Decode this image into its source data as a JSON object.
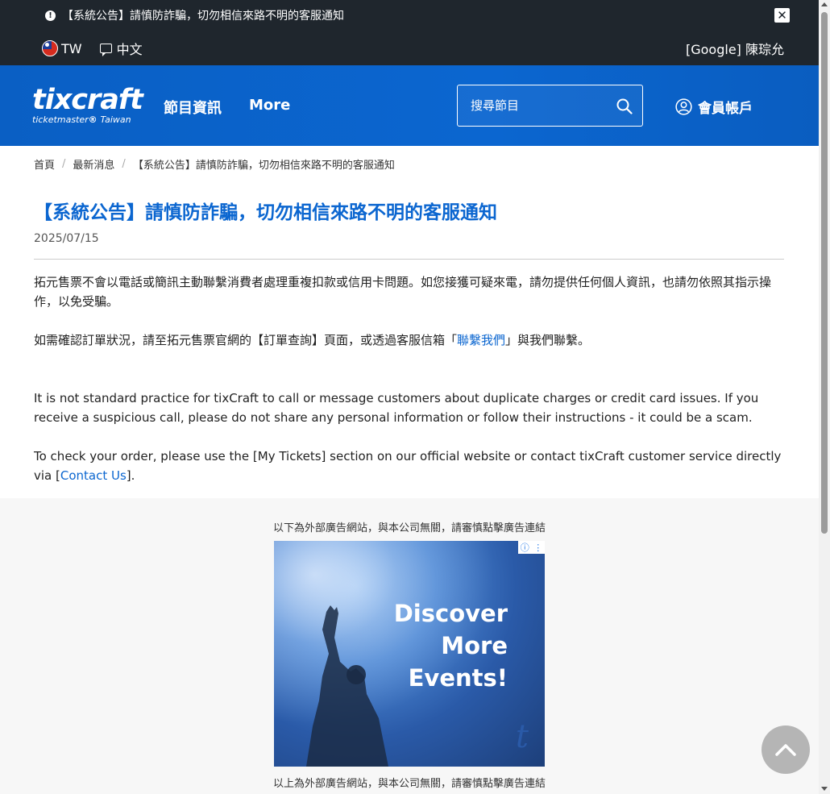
{
  "announcement_bar": {
    "text": "【系統公告】請慎防詐騙，切勿相信來路不明的客服通知",
    "icon": "exclamation-circle-icon",
    "close_icon": "close-icon"
  },
  "locale": {
    "region": "TW",
    "language": "中文",
    "user": "[Google] 陳琮允"
  },
  "header": {
    "logo_main": "tixcraft",
    "logo_sub_brand": "ticketmaster",
    "logo_sub_region": "Taiwan",
    "nav": [
      "節目資訊",
      "More"
    ],
    "search_placeholder": "搜尋節目",
    "account_label": "會員帳戶"
  },
  "breadcrumb": [
    "首頁",
    "最新消息",
    "【系統公告】請慎防詐騙，切勿相信來路不明的客服通知"
  ],
  "article": {
    "title": "【系統公告】請慎防詐騙，切勿相信來路不明的客服通知",
    "date": "2025/07/15",
    "zh_p1": "拓元售票不會以電話或簡訊主動聯繫消費者處理重複扣款或信用卡問題。如您接獲可疑來電，請勿提供任何個人資訊，也請勿依照其指示操作，以免受騙。",
    "zh_p2_before": "如需確認訂單狀況，請至拓元售票官網的【訂單查詢】頁面，或透過客服信箱「",
    "zh_p2_link": "聯繫我們",
    "zh_p2_after": "」與我們聯繫。",
    "en_p1": "It is not standard practice for tixCraft to call or message customers about duplicate charges or credit card issues. If you receive a suspicious call, please do not share any personal information or follow their instructions - it could be a scam.",
    "en_p2_before": "To check your order, please use the [My Tickets] section on our official website or contact tixCraft customer service directly via [",
    "en_p2_link": "Contact Us",
    "en_p2_after": "]."
  },
  "ads": {
    "caption_top": "以下為外部廣告網站，與本公司無關，請審慎點擊廣告連結",
    "caption_bottom": "以上為外部廣告網站，與本公司無關，請審慎點擊廣告連結",
    "line1": "Discover",
    "line2": "More",
    "line3": "Events!",
    "brand_mark": "t"
  },
  "colors": {
    "topbar": "#1f262d",
    "header_blue": "#0b66d0",
    "link": "#0b66d0"
  }
}
